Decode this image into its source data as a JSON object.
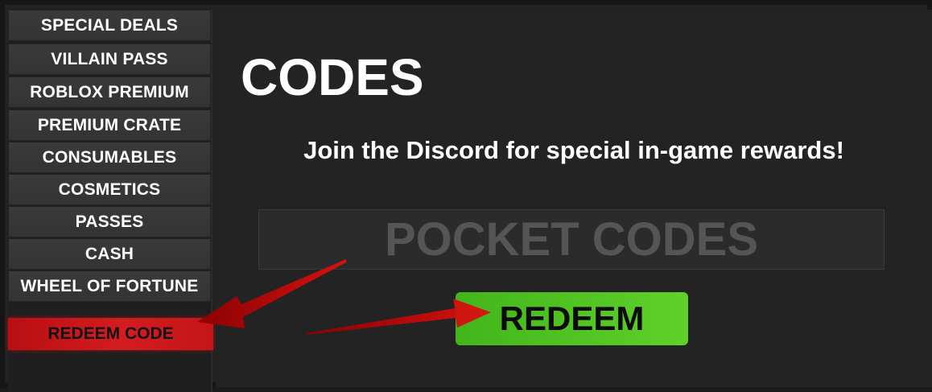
{
  "sidebar": {
    "items": [
      {
        "label": "SPECIAL DEALS"
      },
      {
        "label": "VILLAIN PASS"
      },
      {
        "label": "ROBLOX PREMIUM"
      },
      {
        "label": "PREMIUM CRATE"
      },
      {
        "label": "CONSUMABLES"
      },
      {
        "label": "COSMETICS"
      },
      {
        "label": "PASSES"
      },
      {
        "label": "CASH"
      },
      {
        "label": "WHEEL OF FORTUNE"
      }
    ],
    "redeem_label": "REDEEM CODE"
  },
  "main": {
    "title": "CODES",
    "subtitle": "Join the Discord for special in-game rewards!",
    "code_placeholder": "POCKET CODES",
    "redeem_button": "REDEEM"
  },
  "colors": {
    "accent_red": "#d31c1f",
    "accent_green": "#5fd12a",
    "panel_bg": "#232323"
  }
}
